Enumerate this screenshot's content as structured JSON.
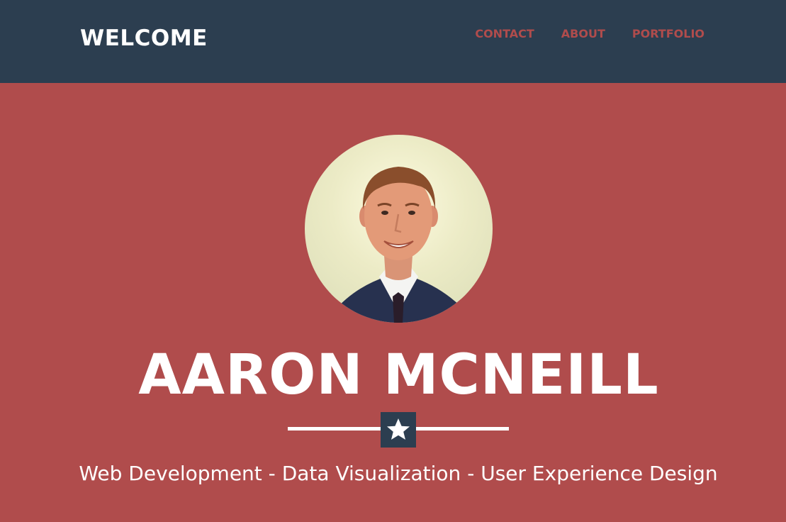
{
  "nav": {
    "brand": "WELCOME",
    "links": [
      "CONTACT",
      "ABOUT",
      "PORTFOLIO"
    ]
  },
  "hero": {
    "name": "AARON MCNEILL",
    "divider_icon": "star-icon",
    "skills": "Web Development - Data Visualization - User Experience Design",
    "avatar_icon": "profile-photo"
  },
  "colors": {
    "navbar": "#2c3e50",
    "hero_background": "#b04c4c",
    "nav_link": "#b04c4c",
    "text": "#ffffff"
  }
}
